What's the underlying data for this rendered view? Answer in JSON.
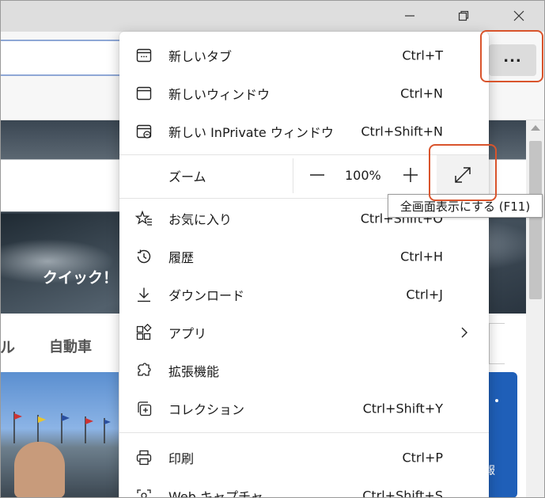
{
  "window": {
    "controls": [
      "minimize-icon",
      "restore-icon",
      "close-icon"
    ]
  },
  "toolbar": {
    "more_label": "..."
  },
  "page": {
    "hero_text": "クイック！",
    "category_partial": "ル",
    "category_car": "自動車",
    "news_right_char": "報"
  },
  "menu": {
    "items": [
      {
        "label": "新しいタブ",
        "shortcut": "Ctrl+T",
        "icon": "new-tab-icon"
      },
      {
        "label": "新しいウィンドウ",
        "shortcut": "Ctrl+N",
        "icon": "new-window-icon"
      },
      {
        "label": "新しい InPrivate ウィンドウ",
        "shortcut": "Ctrl+Shift+N",
        "icon": "inprivate-icon"
      }
    ],
    "zoom": {
      "label": "ズーム",
      "value": "100%",
      "minus": "—",
      "plus": "+"
    },
    "items2": [
      {
        "label": "お気に入り",
        "shortcut": "Ctrl+Shift+O",
        "icon": "favorites-icon"
      },
      {
        "label": "履歴",
        "shortcut": "Ctrl+H",
        "icon": "history-icon"
      },
      {
        "label": "ダウンロード",
        "shortcut": "Ctrl+J",
        "icon": "download-icon"
      },
      {
        "label": "アプリ",
        "shortcut": "",
        "icon": "apps-icon"
      },
      {
        "label": "拡張機能",
        "shortcut": "",
        "icon": "extensions-icon"
      },
      {
        "label": "コレクション",
        "shortcut": "Ctrl+Shift+Y",
        "icon": "collections-icon"
      }
    ],
    "items3": [
      {
        "label": "印刷",
        "shortcut": "Ctrl+P",
        "icon": "print-icon"
      },
      {
        "label": "Web キャプチャ",
        "shortcut": "Ctrl+Shift+S",
        "icon": "web-capture-icon"
      }
    ]
  },
  "tooltip": {
    "text": "全画面表示にする (F11)"
  },
  "colors": {
    "highlight": "#d9542c",
    "accent": "#1f5fb8"
  }
}
